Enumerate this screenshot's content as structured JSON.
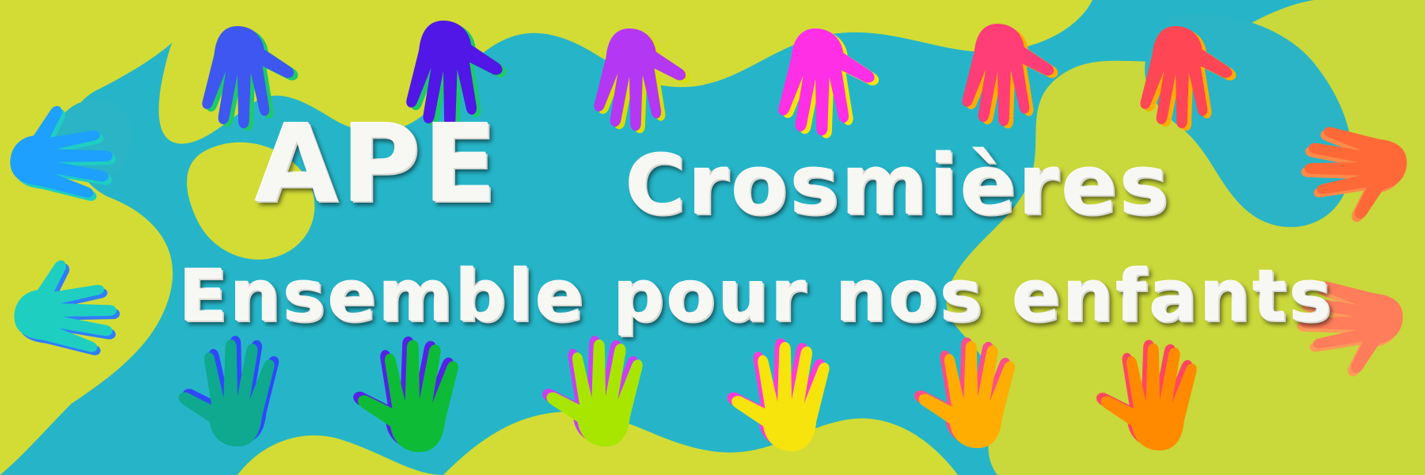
{
  "banner": {
    "title_ape": "APE",
    "title_name": "Crosmières",
    "subtitle": "Ensemble pour nos enfants"
  },
  "colors": {
    "background_blue": "#26b5c8",
    "background_yellow": "#d2dc35",
    "text": "#f7f7f4"
  },
  "hands": {
    "top_row": [
      "#3d57f0",
      "#5117e6",
      "#b437f3",
      "#ff2fe6",
      "#ff3d76",
      "#ff4655"
    ],
    "bottom_row": [
      "#0ea98e",
      "#0dbb37",
      "#a8e600",
      "#f7e40c",
      "#ffad00",
      "#ff8a00"
    ],
    "left_column": [
      "#1da0ff",
      "#1ecfc1"
    ],
    "right_column": [
      "#ff6937",
      "#ff7d5b"
    ]
  }
}
